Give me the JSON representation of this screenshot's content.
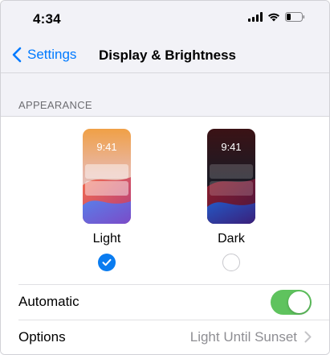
{
  "status_bar": {
    "time": "4:34"
  },
  "nav": {
    "back_label": "Settings",
    "title": "Display & Brightness"
  },
  "appearance": {
    "header": "APPEARANCE",
    "options": [
      {
        "label": "Light",
        "preview_time": "9:41",
        "selected": true
      },
      {
        "label": "Dark",
        "preview_time": "9:41",
        "selected": false
      }
    ]
  },
  "automatic": {
    "label": "Automatic",
    "enabled": true
  },
  "options_row": {
    "label": "Options",
    "value": "Light Until Sunset"
  },
  "colors": {
    "accent": "#007aff",
    "toggle_on": "#5fc35e",
    "radio_selected": "#0a7cf0",
    "grouped_background": "#f2f2f7"
  },
  "icons": [
    "signal-icon",
    "wifi-icon",
    "battery-icon",
    "chevron-left-icon",
    "checkmark-icon",
    "chevron-right-icon"
  ]
}
